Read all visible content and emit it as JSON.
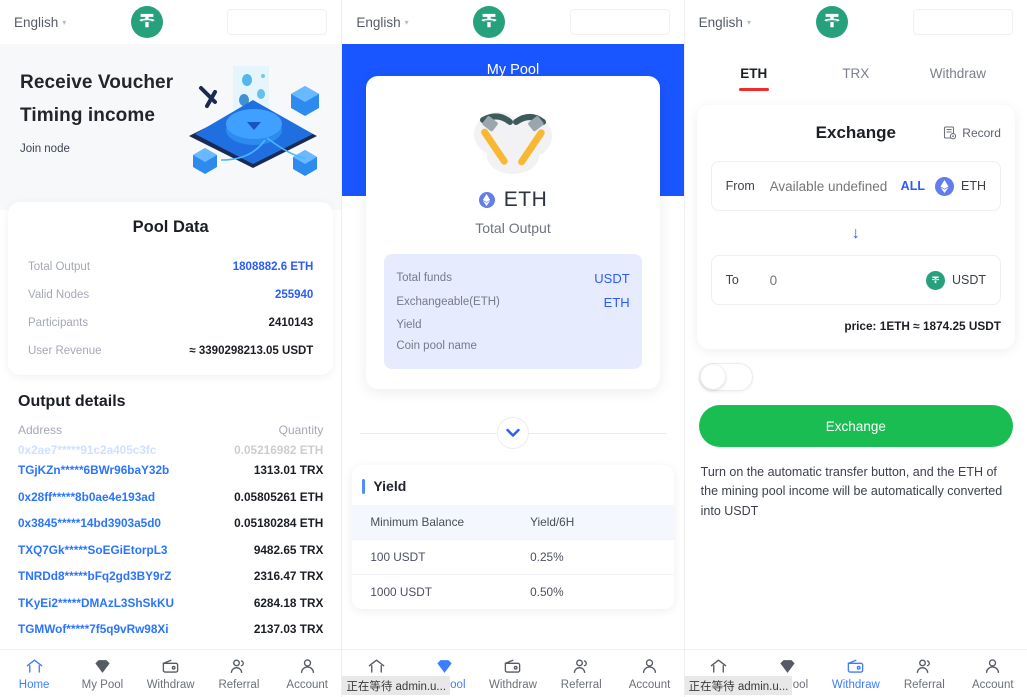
{
  "header": {
    "language": "English",
    "caret": "▾",
    "logo": "tether-logo",
    "box_value": ""
  },
  "panel1": {
    "hero": {
      "line1": "Receive Voucher",
      "line2": "Timing income",
      "sub": "Join node"
    },
    "pool": {
      "title": "Pool Data",
      "rows": [
        {
          "label": "Total Output",
          "value": "1808882.6 ETH",
          "accent": true
        },
        {
          "label": "Valid Nodes",
          "value": "255940",
          "accent": true
        },
        {
          "label": "Participants",
          "value": "2410143",
          "accent": false
        },
        {
          "label": "User Revenue",
          "value": "≈ 3390298213.05 USDT",
          "accent": false
        }
      ]
    },
    "output": {
      "title": "Output details",
      "col_address": "Address",
      "col_quantity": "Quantity",
      "rows": [
        {
          "address": "0x2ae7*****91c2a405c3fc",
          "quantity": "0.05216982 ETH"
        },
        {
          "address": "TGjKZn*****6BWr96baY32b",
          "quantity": "1313.01 TRX"
        },
        {
          "address": "0x28ff*****8b0ae4e193ad",
          "quantity": "0.05805261 ETH"
        },
        {
          "address": "0x3845*****14bd3903a5d0",
          "quantity": "0.05180284 ETH"
        },
        {
          "address": "TXQ7Gk*****SoEGiEtorpL3",
          "quantity": "9482.65 TRX"
        },
        {
          "address": "TNRDd8*****bFq2gd3BY9rZ",
          "quantity": "2316.47 TRX"
        },
        {
          "address": "TKyEi2*****DMAzL3ShSkKU",
          "quantity": "6284.18 TRX"
        },
        {
          "address": "TGMWof*****7f5q9vRw98Xi",
          "quantity": "2137.03 TRX"
        }
      ]
    },
    "nav": [
      {
        "label": "Home",
        "icon": "home-icon",
        "active": true
      },
      {
        "label": "My Pool",
        "icon": "diamond-icon",
        "active": false
      },
      {
        "label": "Withdraw",
        "icon": "wallet-icon",
        "active": false
      },
      {
        "label": "Referral",
        "icon": "referral-icon",
        "active": false
      },
      {
        "label": "Account",
        "icon": "account-icon",
        "active": false
      }
    ]
  },
  "panel2": {
    "title": "My Pool",
    "coin": "ETH",
    "total_output_label": "Total Output",
    "info": [
      {
        "label": "Total funds",
        "value": "USDT"
      },
      {
        "label": "Exchangeable(ETH)",
        "value": "ETH"
      },
      {
        "label": "Yield",
        "value": ""
      },
      {
        "label": "Coin pool name",
        "value": ""
      }
    ],
    "yield": {
      "title": "Yield",
      "col1": "Minimum Balance",
      "col2": "Yield/6H",
      "rows": [
        {
          "balance": "100 USDT",
          "rate": "0.25%"
        },
        {
          "balance": "1000 USDT",
          "rate": "0.50%"
        }
      ]
    },
    "status": "正在等待 admin.u...",
    "nav": [
      {
        "label": "Home",
        "icon": "home-icon",
        "active": false
      },
      {
        "label": "My Pool",
        "icon": "diamond-icon",
        "active": true
      },
      {
        "label": "Withdraw",
        "icon": "wallet-icon",
        "active": false
      },
      {
        "label": "Referral",
        "icon": "referral-icon",
        "active": false
      },
      {
        "label": "Account",
        "icon": "account-icon",
        "active": false
      }
    ]
  },
  "panel3": {
    "tabs": [
      {
        "label": "ETH",
        "active": true
      },
      {
        "label": "TRX",
        "active": false
      },
      {
        "label": "Withdraw",
        "active": false
      }
    ],
    "exchange": {
      "title": "Exchange",
      "record_label": "Record",
      "from_label": "From",
      "from_placeholder": "Available undefined",
      "from_value": "",
      "all_label": "ALL",
      "from_coin": "ETH",
      "swap_arrow": "↓",
      "to_label": "To",
      "to_placeholder": "0",
      "to_value": "",
      "to_coin": "USDT",
      "price": "price: 1ETH ≈ 1874.25 USDT",
      "button": "Exchange",
      "toggle_on": false,
      "hint": "Turn on the automatic transfer button, and the ETH of the mining pool income will be automatically converted into USDT"
    },
    "status": "正在等待 admin.u...",
    "nav": [
      {
        "label": "Home",
        "icon": "home-icon",
        "active": false
      },
      {
        "label": "My Pool",
        "icon": "diamond-icon",
        "active": false
      },
      {
        "label": "Withdraw",
        "icon": "wallet-icon",
        "active": true
      },
      {
        "label": "Referral",
        "icon": "referral-icon",
        "active": false
      },
      {
        "label": "Account",
        "icon": "account-icon",
        "active": false
      }
    ]
  },
  "colors": {
    "brand_green": "#26a17b",
    "blue": "#1a56ff",
    "link_blue": "#2a74ff",
    "red": "#ef2b2b",
    "button_green": "#19bd52"
  }
}
